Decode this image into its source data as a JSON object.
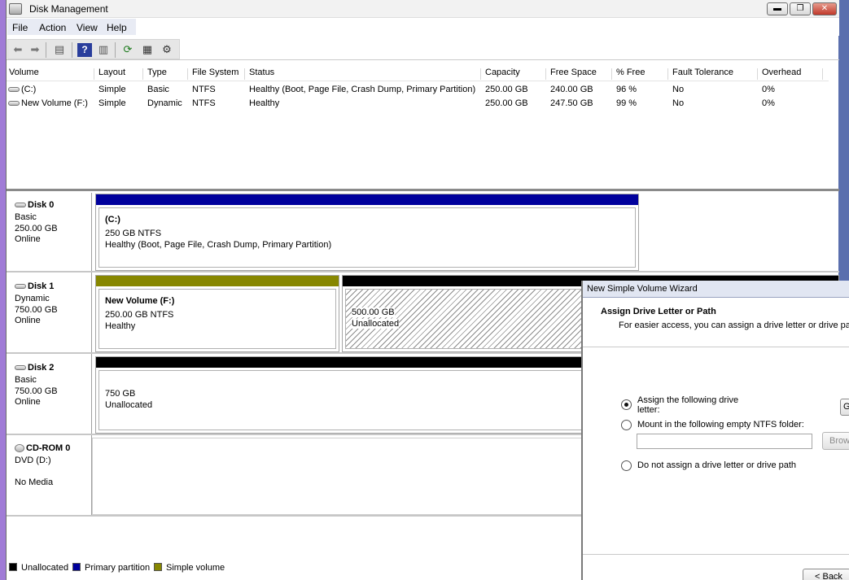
{
  "window": {
    "title": "Disk Management"
  },
  "menu": [
    "File",
    "Action",
    "View",
    "Help"
  ],
  "volume_table": {
    "columns": [
      "Volume",
      "Layout",
      "Type",
      "File System",
      "Status",
      "Capacity",
      "Free Space",
      "% Free",
      "Fault Tolerance",
      "Overhead"
    ],
    "rows": [
      {
        "volume": "(C:)",
        "layout": "Simple",
        "type": "Basic",
        "fs": "NTFS",
        "status": "Healthy (Boot, Page File, Crash Dump, Primary Partition)",
        "capacity": "250.00 GB",
        "free": "240.00 GB",
        "pct": "96 %",
        "fault": "No",
        "overhead": "0%"
      },
      {
        "volume": "New Volume (F:)",
        "layout": "Simple",
        "type": "Dynamic",
        "fs": "NTFS",
        "status": "Healthy",
        "capacity": "250.00 GB",
        "free": "247.50 GB",
        "pct": "99 %",
        "fault": "No",
        "overhead": "0%"
      }
    ]
  },
  "disks": [
    {
      "name": "Disk 0",
      "type": "Basic",
      "size": "250.00 GB",
      "state": "Online",
      "partitions": [
        {
          "title": "(C:)",
          "size": "250 GB NTFS",
          "status": "Healthy (Boot, Page File, Crash Dump, Primary Partition)"
        }
      ]
    },
    {
      "name": "Disk 1",
      "type": "Dynamic",
      "size": "750.00 GB",
      "state": "Online",
      "partitions": [
        {
          "title": "New Volume  (F:)",
          "size": "250.00 GB NTFS",
          "status": "Healthy"
        },
        {
          "size": "500.00 GB",
          "status": "Unallocated"
        }
      ]
    },
    {
      "name": "Disk 2",
      "type": "Basic",
      "size": "750.00 GB",
      "state": "Online",
      "partitions": [
        {
          "size": "750 GB",
          "status": "Unallocated"
        }
      ]
    },
    {
      "name": "CD-ROM 0",
      "type": "DVD (D:)",
      "state": "No Media"
    }
  ],
  "legend": [
    {
      "label": "Unallocated",
      "color": "#000000"
    },
    {
      "label": "Primary partition",
      "color": "#00009c"
    },
    {
      "label": "Simple volume",
      "color": "#878700"
    }
  ],
  "wizard": {
    "title": "New Simple Volume Wizard",
    "heading": "Assign Drive Letter or Path",
    "subheading": "For easier access, you can assign a drive letter or drive pat",
    "options": [
      {
        "label": "Assign the following drive letter:",
        "selected": true
      },
      {
        "label": "Mount in the following empty NTFS folder:",
        "selected": false
      },
      {
        "label": "Do not assign a drive letter or drive path",
        "selected": false
      }
    ],
    "drive_letter_partial": "G",
    "browse_label": "Brow",
    "back_label": "< Back"
  }
}
